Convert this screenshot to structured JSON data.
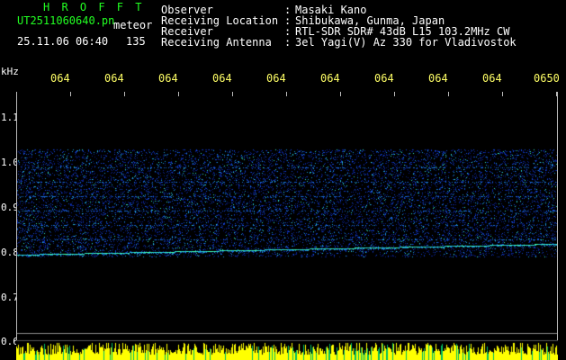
{
  "header": {
    "app_name": "H R O F F T",
    "filename": "UT2511060640.pn",
    "suffix": "meteor",
    "datetime": "25.11.06 06:40",
    "count": "135"
  },
  "info": [
    {
      "label": "Observer",
      "value": "Masaki Kano"
    },
    {
      "label": "Receiving Location",
      "value": "Shibukawa, Gunma, Japan"
    },
    {
      "label": "Receiver",
      "value": "RTL-SDR SDR# 43dB L15 103.2MHz CW"
    },
    {
      "label": "Receiving Antenna",
      "value": "3el Yagi(V) Az 330 for Vladivostok"
    }
  ],
  "info_separator": ":",
  "axis": {
    "y_unit": "kHz",
    "y_ticks": [
      "1.1",
      "1.0",
      "0.9",
      "0.8",
      "0.7",
      "0.6"
    ],
    "x_ticks": [
      "064",
      "064",
      "064",
      "064",
      "064",
      "064",
      "064",
      "064",
      "064",
      "0650"
    ]
  },
  "colors": {
    "background": "#000000",
    "title": "#22ff22",
    "text": "#ffffff",
    "time_ticks": "#ffff66",
    "echo_band": "#ffff00",
    "noise": "#1133aa"
  }
}
